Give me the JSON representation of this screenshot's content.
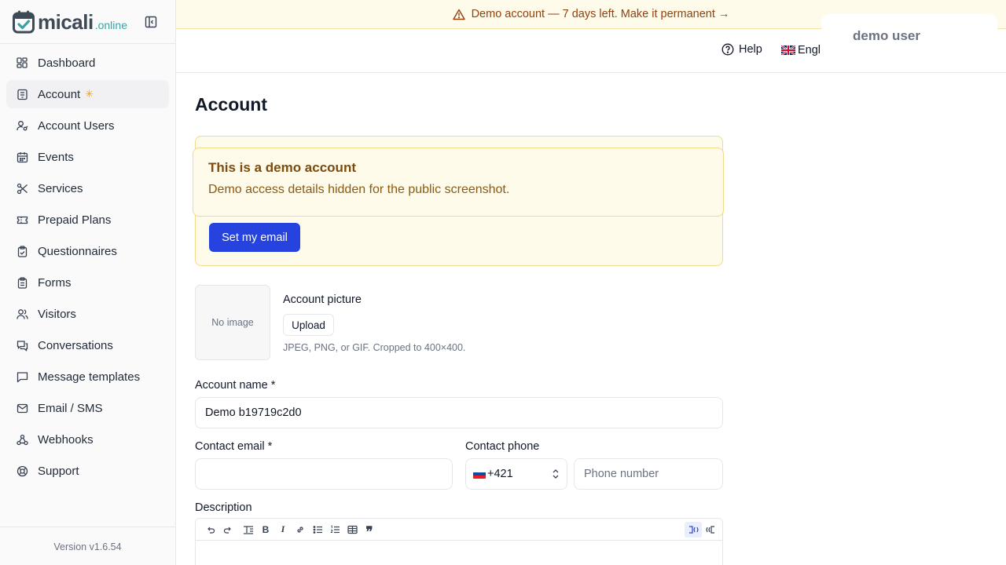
{
  "brand": {
    "name": "micali",
    "tld": ".online"
  },
  "sidebar": {
    "items": [
      {
        "label": "Dashboard",
        "icon": "dashboard-icon"
      },
      {
        "label": "Account",
        "icon": "building-icon",
        "active": true,
        "badge": "✳"
      },
      {
        "label": "Account Users",
        "icon": "user-key-icon"
      },
      {
        "label": "Events",
        "icon": "calendar-icon"
      },
      {
        "label": "Services",
        "icon": "scissors-icon"
      },
      {
        "label": "Prepaid Plans",
        "icon": "ticket-icon"
      },
      {
        "label": "Questionnaires",
        "icon": "clipboard-icon"
      },
      {
        "label": "Forms",
        "icon": "clipboard-list-icon"
      },
      {
        "label": "Visitors",
        "icon": "users-icon"
      },
      {
        "label": "Conversations",
        "icon": "messages-icon"
      },
      {
        "label": "Message templates",
        "icon": "message-square-icon"
      },
      {
        "label": "Email / SMS",
        "icon": "mail-icon"
      },
      {
        "label": "Webhooks",
        "icon": "webhook-icon"
      },
      {
        "label": "Support",
        "icon": "lifebuoy-icon"
      }
    ],
    "version": "Version v1.6.54"
  },
  "banner": {
    "text": "Demo account — 7 days left. Make it permanent →",
    "color": "#92400e"
  },
  "topbar": {
    "help": "Help",
    "language": "Engl",
    "user": "demo user"
  },
  "main": {
    "title": "Account",
    "demo": {
      "title": "This is a demo account",
      "text": "Demo access details hidden for the public screenshot.",
      "button": "Set my email"
    },
    "picture": {
      "placeholder": "No image",
      "label": "Account picture",
      "upload": "Upload",
      "hint": "JPEG, PNG, or GIF. Cropped to 400×400."
    },
    "account_name": {
      "label": "Account name *",
      "value": "Demo b19719c2d0"
    },
    "contact_email": {
      "label": "Contact email *",
      "value": ""
    },
    "contact_phone": {
      "label": "Contact phone",
      "code": "+421",
      "placeholder": "Phone number"
    },
    "description": {
      "label": "Description"
    }
  },
  "colors": {
    "accent": "#2643e0",
    "banner_bg": "#fefbea",
    "warning_text": "#7a4c0f"
  }
}
